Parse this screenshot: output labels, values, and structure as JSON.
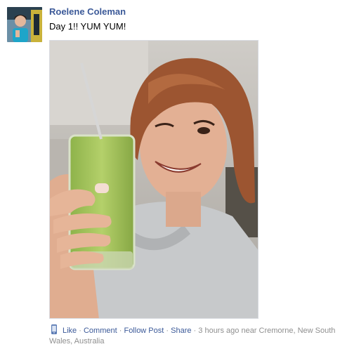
{
  "post": {
    "author": "Roelene Coleman",
    "message": "Day 1!! YUM YUM!",
    "actions": {
      "like": "Like",
      "comment": "Comment",
      "follow": "Follow Post",
      "share": "Share"
    },
    "separator": "·",
    "timestamp": "3 hours ago",
    "location_prefix": "near",
    "location": "Cremorne, New South Wales, Australia"
  },
  "colors": {
    "link": "#3b5998",
    "meta_text": "#8f8f8f"
  },
  "icons": {
    "footer": "mobile-phone-icon"
  }
}
